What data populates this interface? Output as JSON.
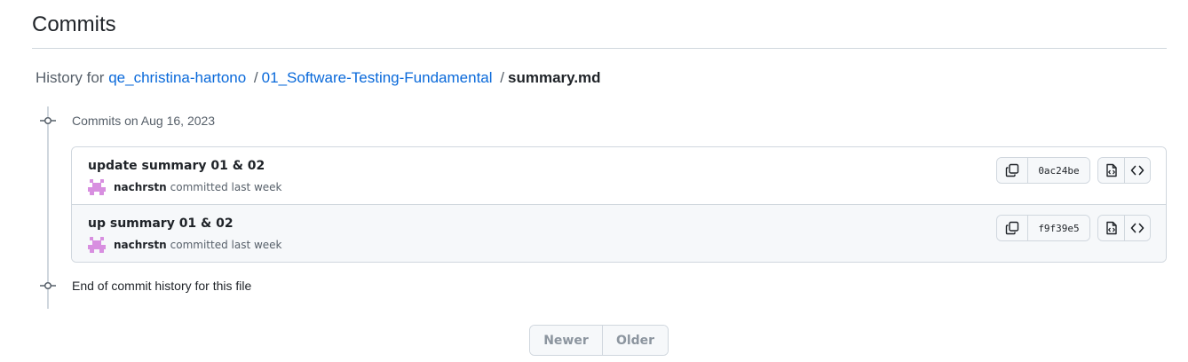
{
  "page": {
    "title": "Commits"
  },
  "breadcrumb": {
    "prefix": "History for",
    "repo": "qe_christina-hartono",
    "separator": "/",
    "folder": "01_Software-Testing-Fundamental",
    "file": "summary.md"
  },
  "timeline": {
    "group_label": "Commits on Aug 16, 2023",
    "end_label": "End of commit history for this file"
  },
  "commits": [
    {
      "message": "update summary 01 & 02",
      "author": "nachrstn",
      "meta": "committed last week",
      "sha": "0ac24be"
    },
    {
      "message": "up summary 01 & 02",
      "author": "nachrstn",
      "meta": "committed last week",
      "sha": "f9f39e5"
    }
  ],
  "pagination": {
    "newer": "Newer",
    "older": "Older"
  },
  "icons": {
    "copy": "copy-icon",
    "browse": "file-code-icon",
    "code": "code-icon",
    "node": "git-commit-icon",
    "avatar": "avatar-identicon"
  },
  "colors": {
    "link": "#0969da",
    "avatar": "#d88fe0",
    "border": "#d0d7de",
    "muted": "#57606a"
  }
}
